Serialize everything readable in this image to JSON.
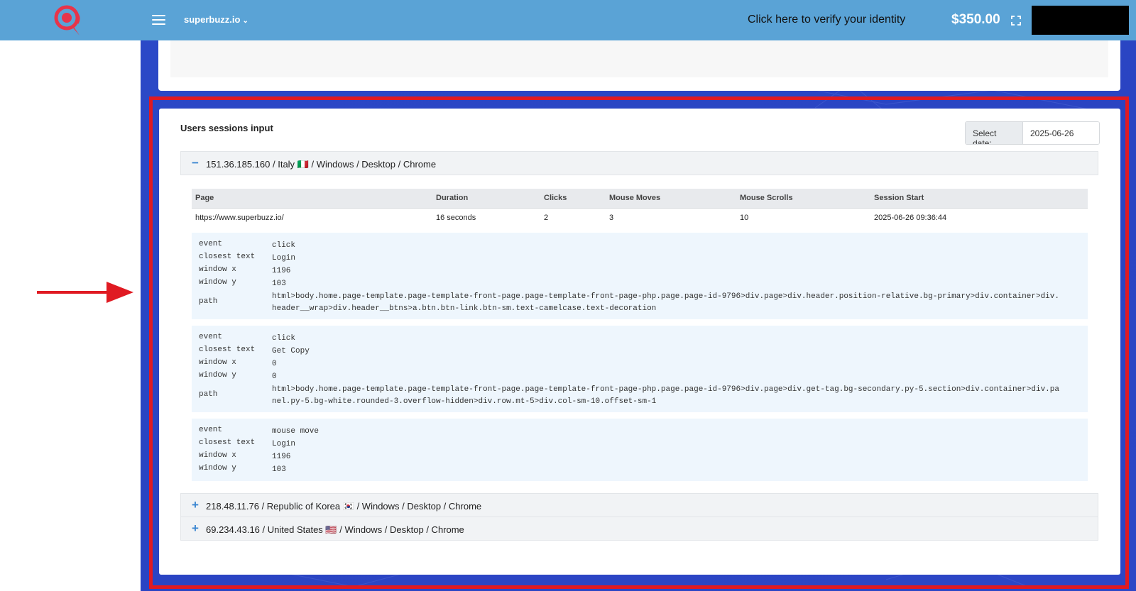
{
  "topbar": {
    "site": "superbuzz.io",
    "verify_text": "Click here to verify your identity",
    "balance": "$350.00"
  },
  "card": {
    "title": "Users sessions input",
    "date_label": "Select date:",
    "date_value": "2025-06-26"
  },
  "sessions": [
    {
      "toggle": "−",
      "ip": "151.36.185.160",
      "country": "Italy",
      "flag": "🇮🇹",
      "rest": "/ Windows / Desktop / Chrome",
      "expanded": true
    },
    {
      "toggle": "+",
      "ip": "218.48.11.76",
      "country": "Republic of Korea",
      "flag": "🇰🇷",
      "rest": "/ Windows / Desktop / Chrome",
      "expanded": false
    },
    {
      "toggle": "+",
      "ip": "69.234.43.16",
      "country": "United States",
      "flag": "🇺🇸",
      "rest": "/ Windows / Desktop / Chrome",
      "expanded": false
    }
  ],
  "table": {
    "headers": [
      "Page",
      "Duration",
      "Clicks",
      "Mouse Moves",
      "Mouse Scrolls",
      "Session Start"
    ],
    "row": [
      "https://www.superbuzz.io/",
      "16 seconds",
      "2",
      "3",
      "10",
      "2025-06-26 09:36:44"
    ]
  },
  "events": [
    {
      "event_key": "event",
      "event": "click",
      "text_key": "closest text",
      "text": "Login",
      "x_key": "window x",
      "x": "1196",
      "y_key": "window y",
      "y": "103",
      "path_key": "path",
      "path": "html>body.home.page-template.page-template-front-page.page-template-front-page-php.page.page-id-9796>div.page>div.header.position-relative.bg-primary>div.container>div.header__wrap>div.header__btns>a.btn.btn-link.btn-sm.text-camelcase.text-decoration"
    },
    {
      "event_key": "event",
      "event": "click",
      "text_key": "closest text",
      "text": "Get Copy",
      "x_key": "window x",
      "x": "0",
      "y_key": "window y",
      "y": "0",
      "path_key": "path",
      "path": "html>body.home.page-template.page-template-front-page.page-template-front-page-php.page.page-id-9796>div.page>div.get-tag.bg-secondary.py-5.section>div.container>div.panel.py-5.bg-white.rounded-3.overflow-hidden>div.row.mt-5>div.col-sm-10.offset-sm-1"
    },
    {
      "event_key": "event",
      "event": "mouse move",
      "text_key": "closest text",
      "text": "Login",
      "x_key": "window x",
      "x": "1196",
      "y_key": "window y",
      "y": "103"
    }
  ]
}
